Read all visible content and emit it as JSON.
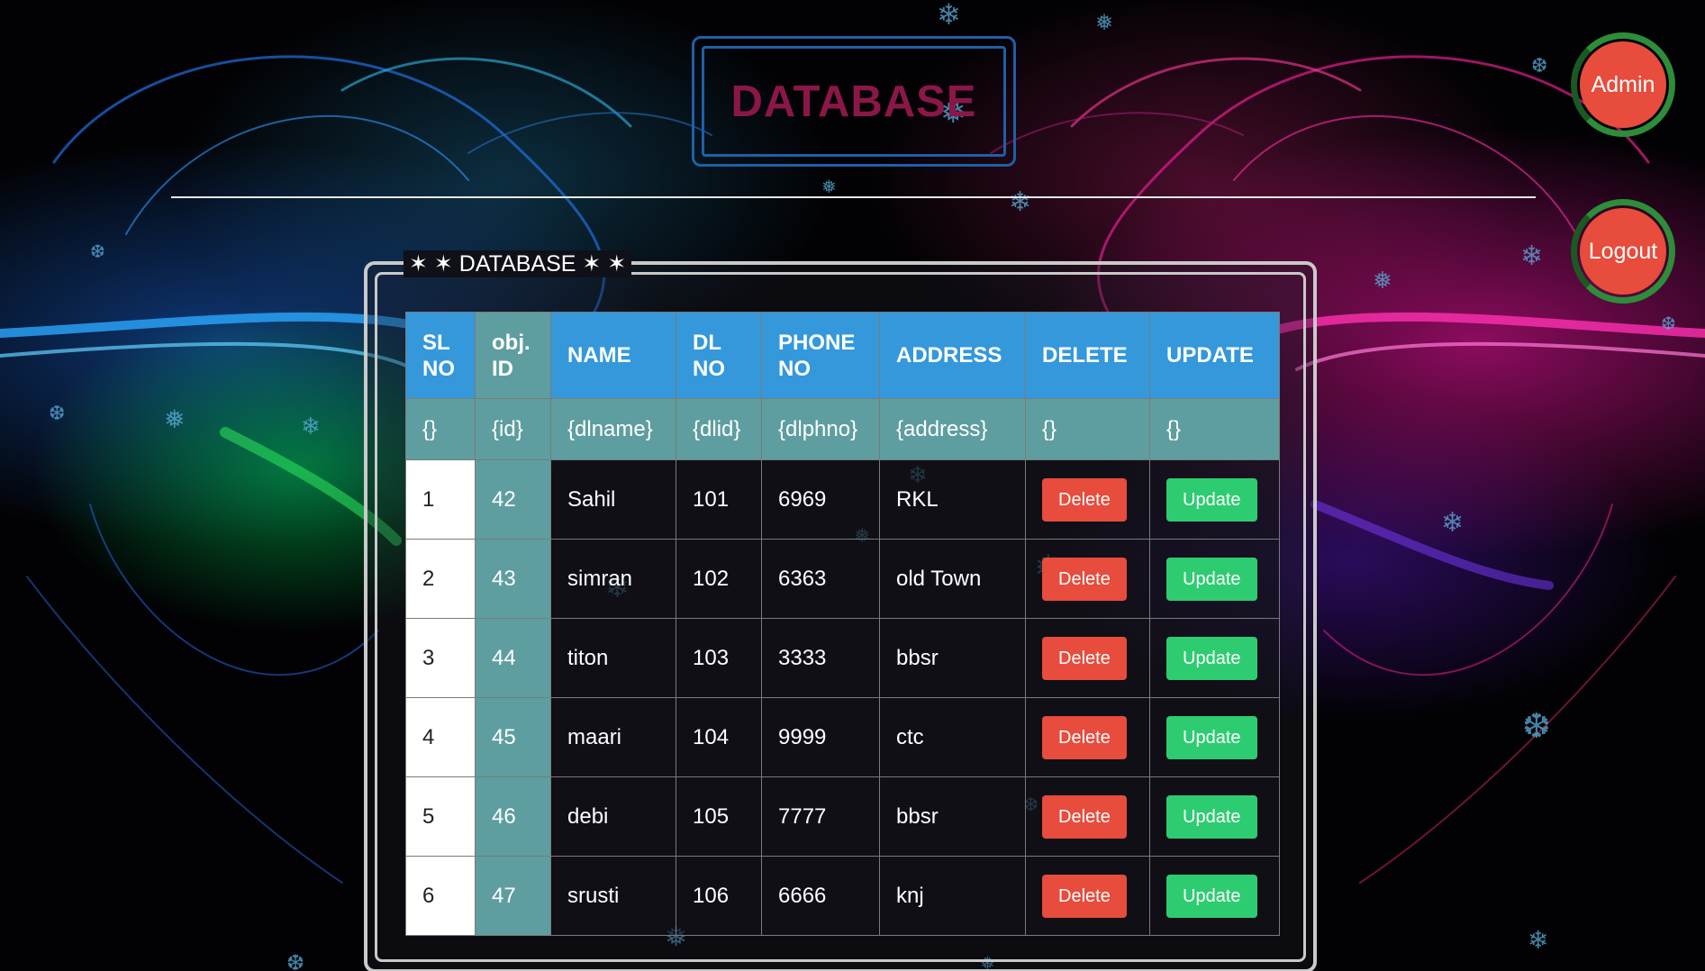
{
  "header": {
    "title": "DATABASE",
    "admin_button": "Admin",
    "logout_button": "Logout"
  },
  "panel": {
    "legend": "✶ ✶ DATABASE ✶ ✶"
  },
  "table": {
    "columns": [
      "SL NO",
      "obj. ID",
      "NAME",
      "DL NO",
      "PHONE NO",
      "ADDRESS",
      "DELETE",
      "UPDATE"
    ],
    "placeholders": [
      "{}",
      "{id}",
      "{dlname}",
      "{dlid}",
      "{dlphno}",
      "{address}",
      "{}",
      "{}"
    ],
    "rows": [
      {
        "sl": "1",
        "id": "42",
        "name": "Sahil",
        "dl": "101",
        "phone": "6969",
        "address": "RKL",
        "delete": "Delete",
        "update": "Update"
      },
      {
        "sl": "2",
        "id": "43",
        "name": "simran",
        "dl": "102",
        "phone": "6363",
        "address": "old Town",
        "delete": "Delete",
        "update": "Update"
      },
      {
        "sl": "3",
        "id": "44",
        "name": "titon",
        "dl": "103",
        "phone": "3333",
        "address": "bbsr",
        "delete": "Delete",
        "update": "Update"
      },
      {
        "sl": "4",
        "id": "45",
        "name": "maari",
        "dl": "104",
        "phone": "9999",
        "address": "ctc",
        "delete": "Delete",
        "update": "Update"
      },
      {
        "sl": "5",
        "id": "46",
        "name": "debi",
        "dl": "105",
        "phone": "7777",
        "address": "bbsr",
        "delete": "Delete",
        "update": "Update"
      },
      {
        "sl": "6",
        "id": "47",
        "name": "srusti",
        "dl": "106",
        "phone": "6666",
        "address": "knj",
        "delete": "Delete",
        "update": "Update"
      }
    ]
  },
  "colors": {
    "header_blue": "#3498db",
    "teal": "#5f9ea0",
    "delete_red": "#e74c3c",
    "update_green": "#2ecc71",
    "title_crimson": "#8a1747",
    "frame_blue": "#1f5fa8",
    "ring_green": "#2d8d3a"
  },
  "icons": [
    "snowflake-icon"
  ]
}
